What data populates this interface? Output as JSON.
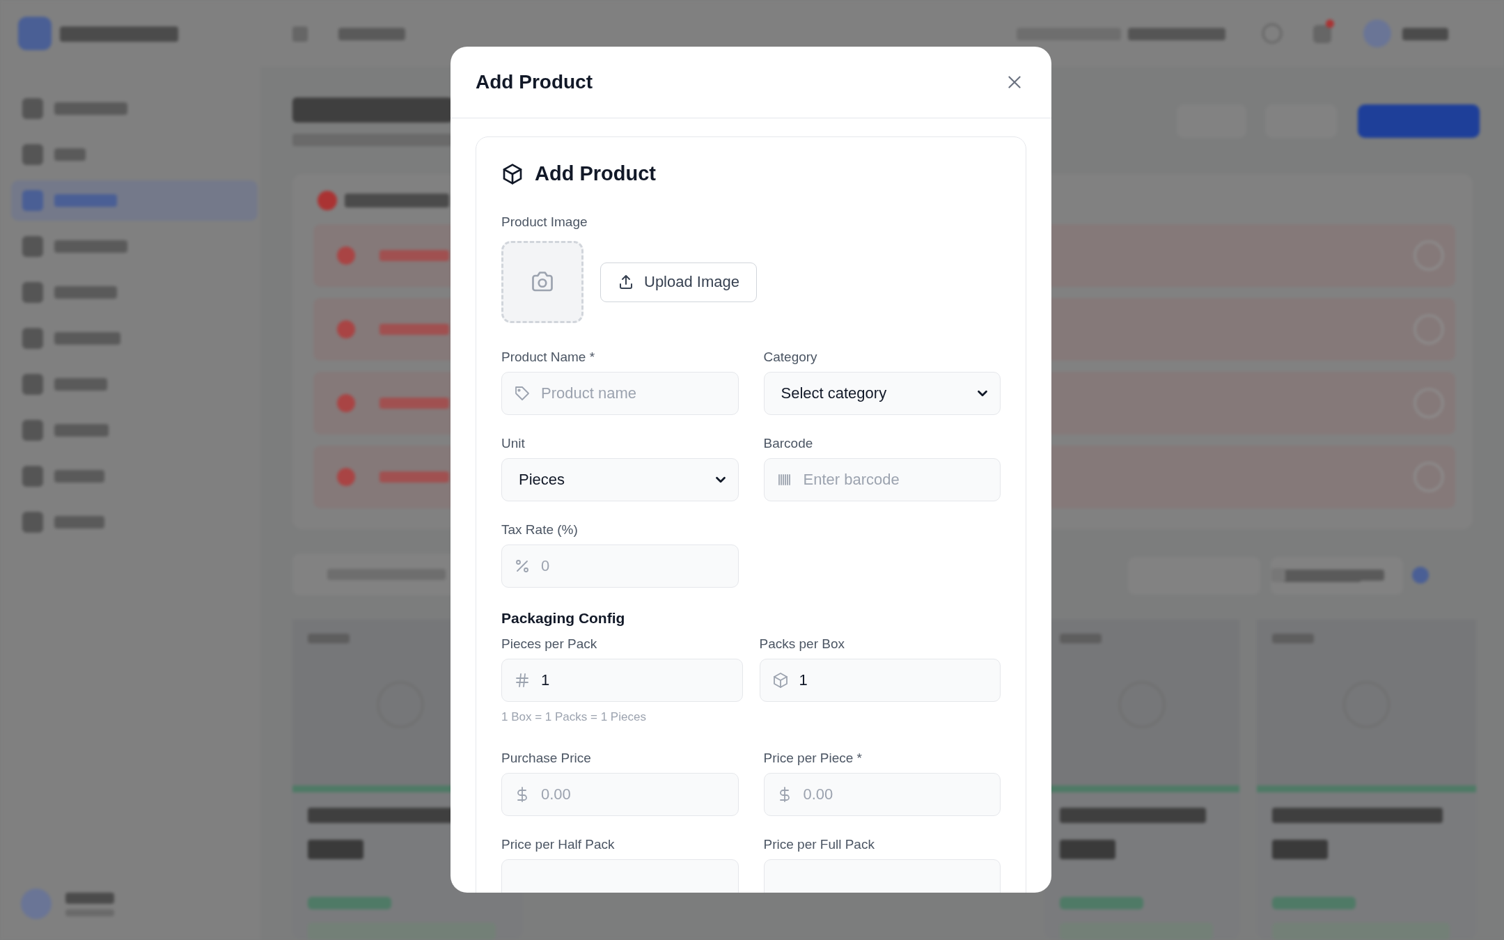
{
  "modal": {
    "title": "Add Product",
    "card_title": "Add Product",
    "image_label": "Product Image",
    "upload_button": "Upload Image",
    "fields": [
      {
        "label": "Product Name *",
        "kind": "input",
        "placeholder": "Product name"
      },
      {
        "label": "Category",
        "kind": "select",
        "value": "Select category"
      },
      {
        "label": "Unit",
        "kind": "select",
        "value": "Pieces"
      },
      {
        "label": "Barcode",
        "kind": "input",
        "placeholder": "Enter barcode"
      },
      {
        "label": "Tax Rate (%)",
        "kind": "input",
        "placeholder": "0"
      }
    ],
    "packaging": {
      "title": "Packaging Config",
      "fields": [
        {
          "label": "Pieces per Pack",
          "kind": "input",
          "value": "1"
        },
        {
          "label": "Packs per Box",
          "kind": "input",
          "value": "1"
        }
      ],
      "hint": "1 Box = 1 Packs = 1 Pieces"
    },
    "prices": [
      {
        "label": "Purchase Price",
        "kind": "input",
        "placeholder": "0.00"
      },
      {
        "label": "Price per Piece *",
        "kind": "input",
        "placeholder": "0.00"
      },
      {
        "label": "Price per Half Pack",
        "kind": "input"
      },
      {
        "label": "Price per Full Pack",
        "kind": "input"
      }
    ]
  }
}
